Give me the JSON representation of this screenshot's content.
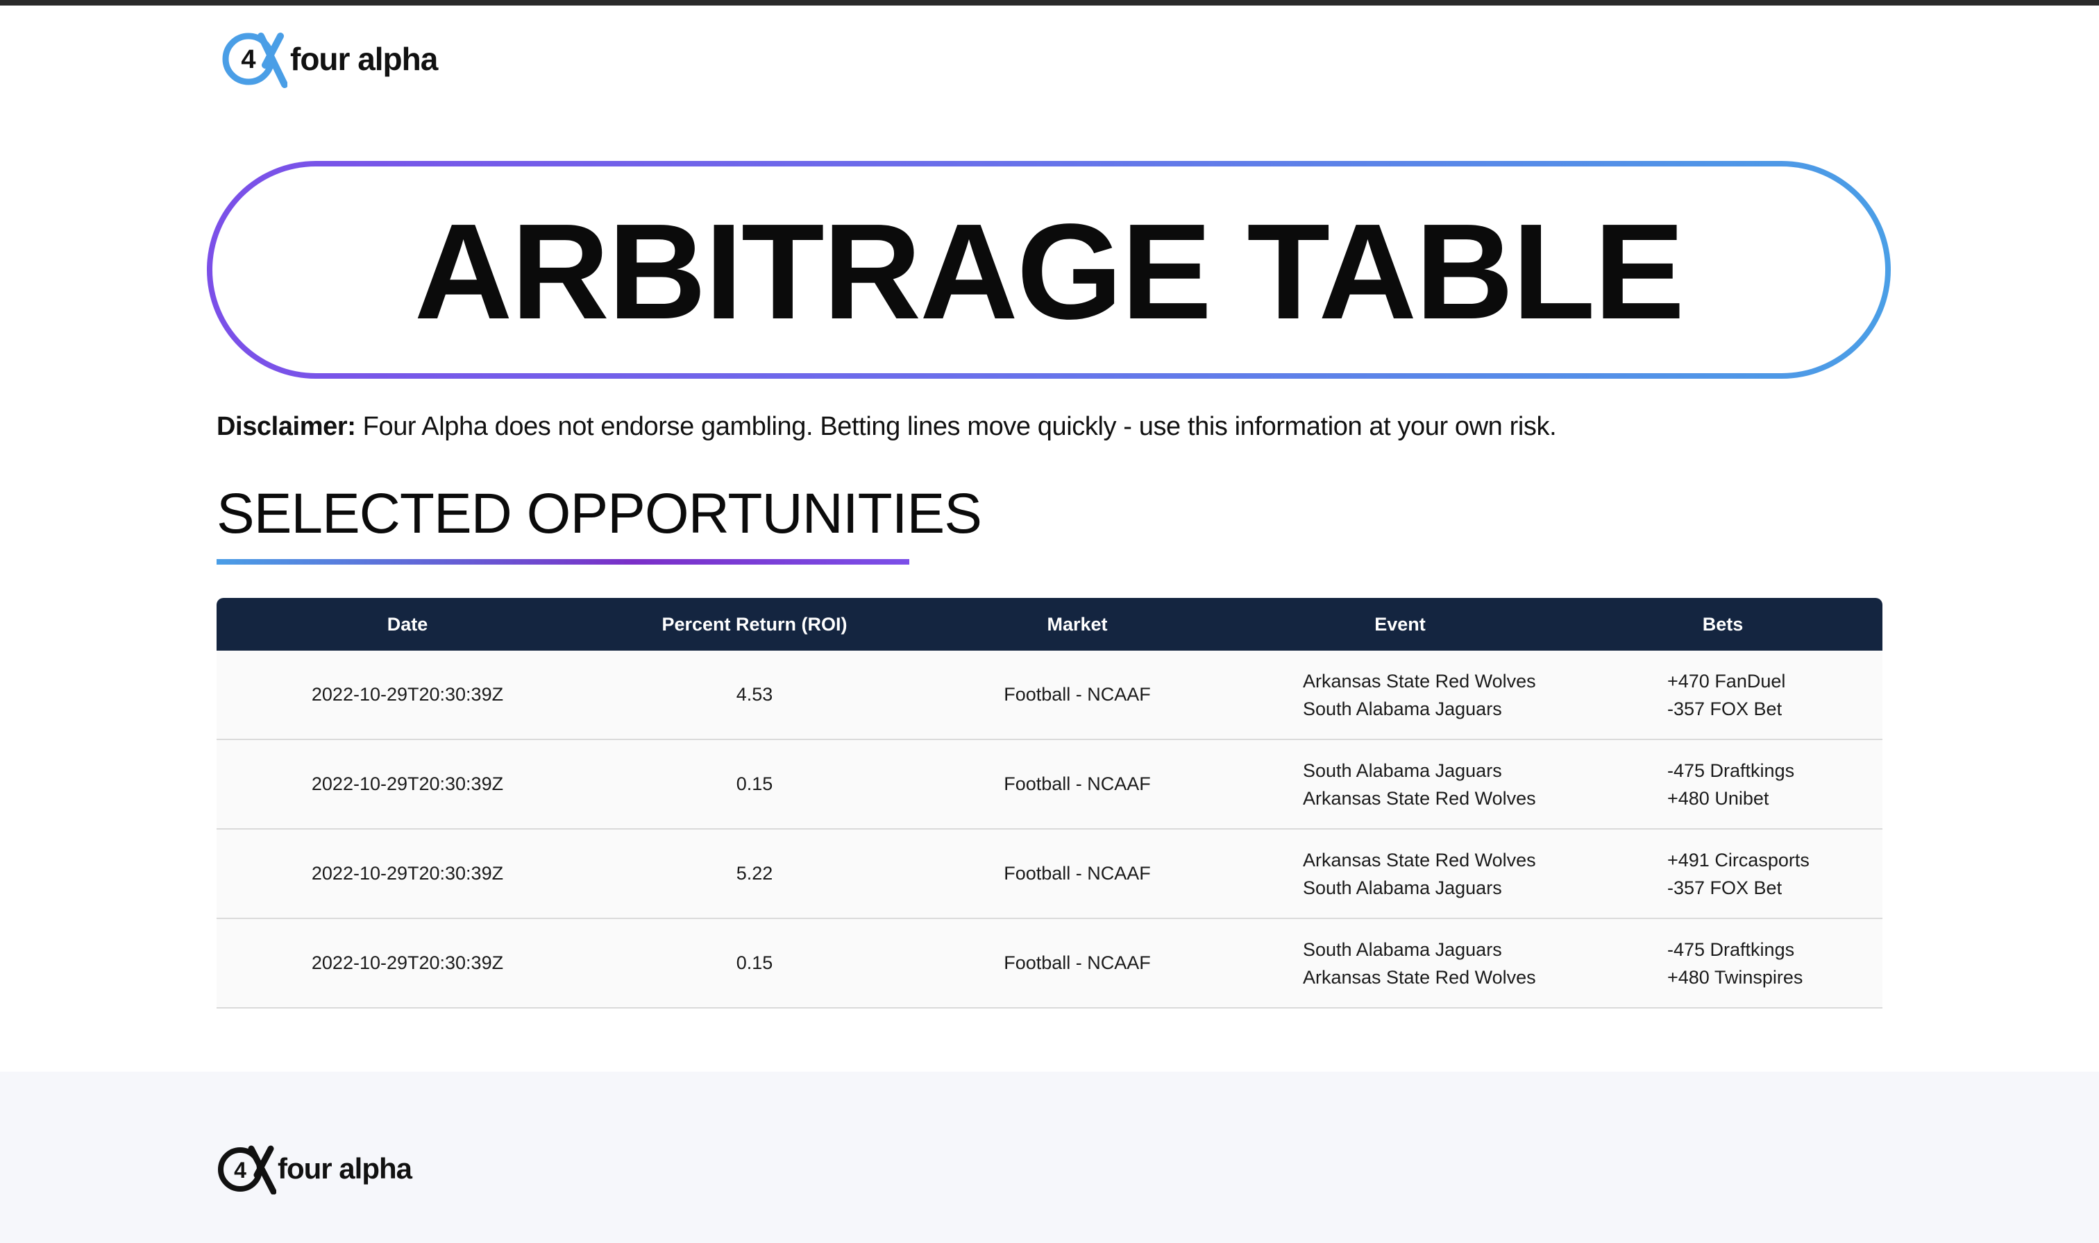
{
  "brand": {
    "name": "four alpha",
    "mark_text": "4",
    "colors": {
      "accent_blue": "#4a9ee6",
      "accent_purple": "#7b4fe8",
      "table_header": "#142540"
    }
  },
  "hero": {
    "title": "ARBITRAGE TABLE"
  },
  "disclaimer": {
    "label": "Disclaimer:",
    "text": "Four Alpha does not endorse gambling. Betting lines move quickly - use this information at your own risk."
  },
  "section": {
    "title": "SELECTED OPPORTUNITIES"
  },
  "table": {
    "headers": [
      "Date",
      "Percent Return (ROI)",
      "Market",
      "Event",
      "Bets"
    ],
    "rows": [
      {
        "date": "2022-10-29T20:30:39Z",
        "roi": "4.53",
        "market": "Football - NCAAF",
        "event": [
          "Arkansas State Red Wolves",
          "South Alabama Jaguars"
        ],
        "bets": [
          "+470 FanDuel",
          "-357 FOX Bet"
        ]
      },
      {
        "date": "2022-10-29T20:30:39Z",
        "roi": "0.15",
        "market": "Football - NCAAF",
        "event": [
          "South Alabama Jaguars",
          "Arkansas State Red Wolves"
        ],
        "bets": [
          "-475 Draftkings",
          "+480 Unibet"
        ]
      },
      {
        "date": "2022-10-29T20:30:39Z",
        "roi": "5.22",
        "market": "Football - NCAAF",
        "event": [
          "Arkansas State Red Wolves",
          "South Alabama Jaguars"
        ],
        "bets": [
          "+491 Circasports",
          "-357 FOX Bet"
        ]
      },
      {
        "date": "2022-10-29T20:30:39Z",
        "roi": "0.15",
        "market": "Football - NCAAF",
        "event": [
          "South Alabama Jaguars",
          "Arkansas State Red Wolves"
        ],
        "bets": [
          "-475 Draftkings",
          "+480 Twinspires"
        ]
      }
    ]
  },
  "footer": {
    "brand_name": "four alpha"
  }
}
